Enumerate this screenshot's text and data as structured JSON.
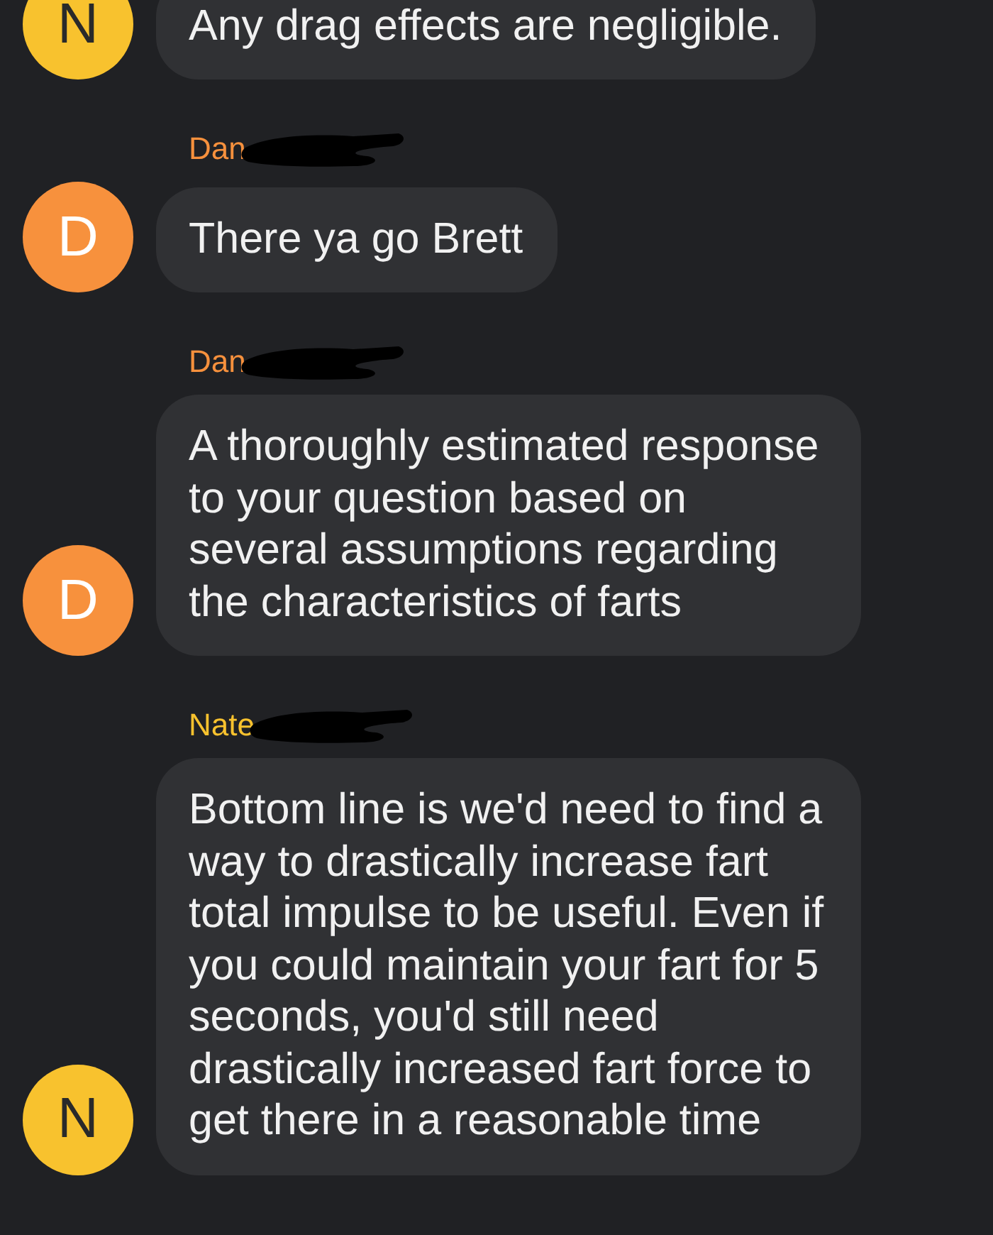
{
  "messages": [
    {
      "avatar": {
        "letter": "N",
        "color": "#f8c22e"
      },
      "text": "Any drag effects are negligible."
    },
    {
      "sender": "Dan",
      "redacted": true,
      "avatar": {
        "letter": "D",
        "color": "#f7913d"
      },
      "text": "There ya go Brett"
    },
    {
      "sender": "Dan",
      "redacted": true,
      "avatar": {
        "letter": "D",
        "color": "#f7913d"
      },
      "text": "A thoroughly estimated response to your question based on several assumptions regarding the characteristics of farts"
    },
    {
      "sender": "Nate",
      "redacted": true,
      "avatar": {
        "letter": "N",
        "color": "#f8c22e"
      },
      "text": "Bottom line is we'd need to find a way to drastically increase fart total impulse to be useful. Even if you could maintain your fart for 5 seconds, you'd still need drastically increased fart force to get there in a reasonable time"
    }
  ]
}
